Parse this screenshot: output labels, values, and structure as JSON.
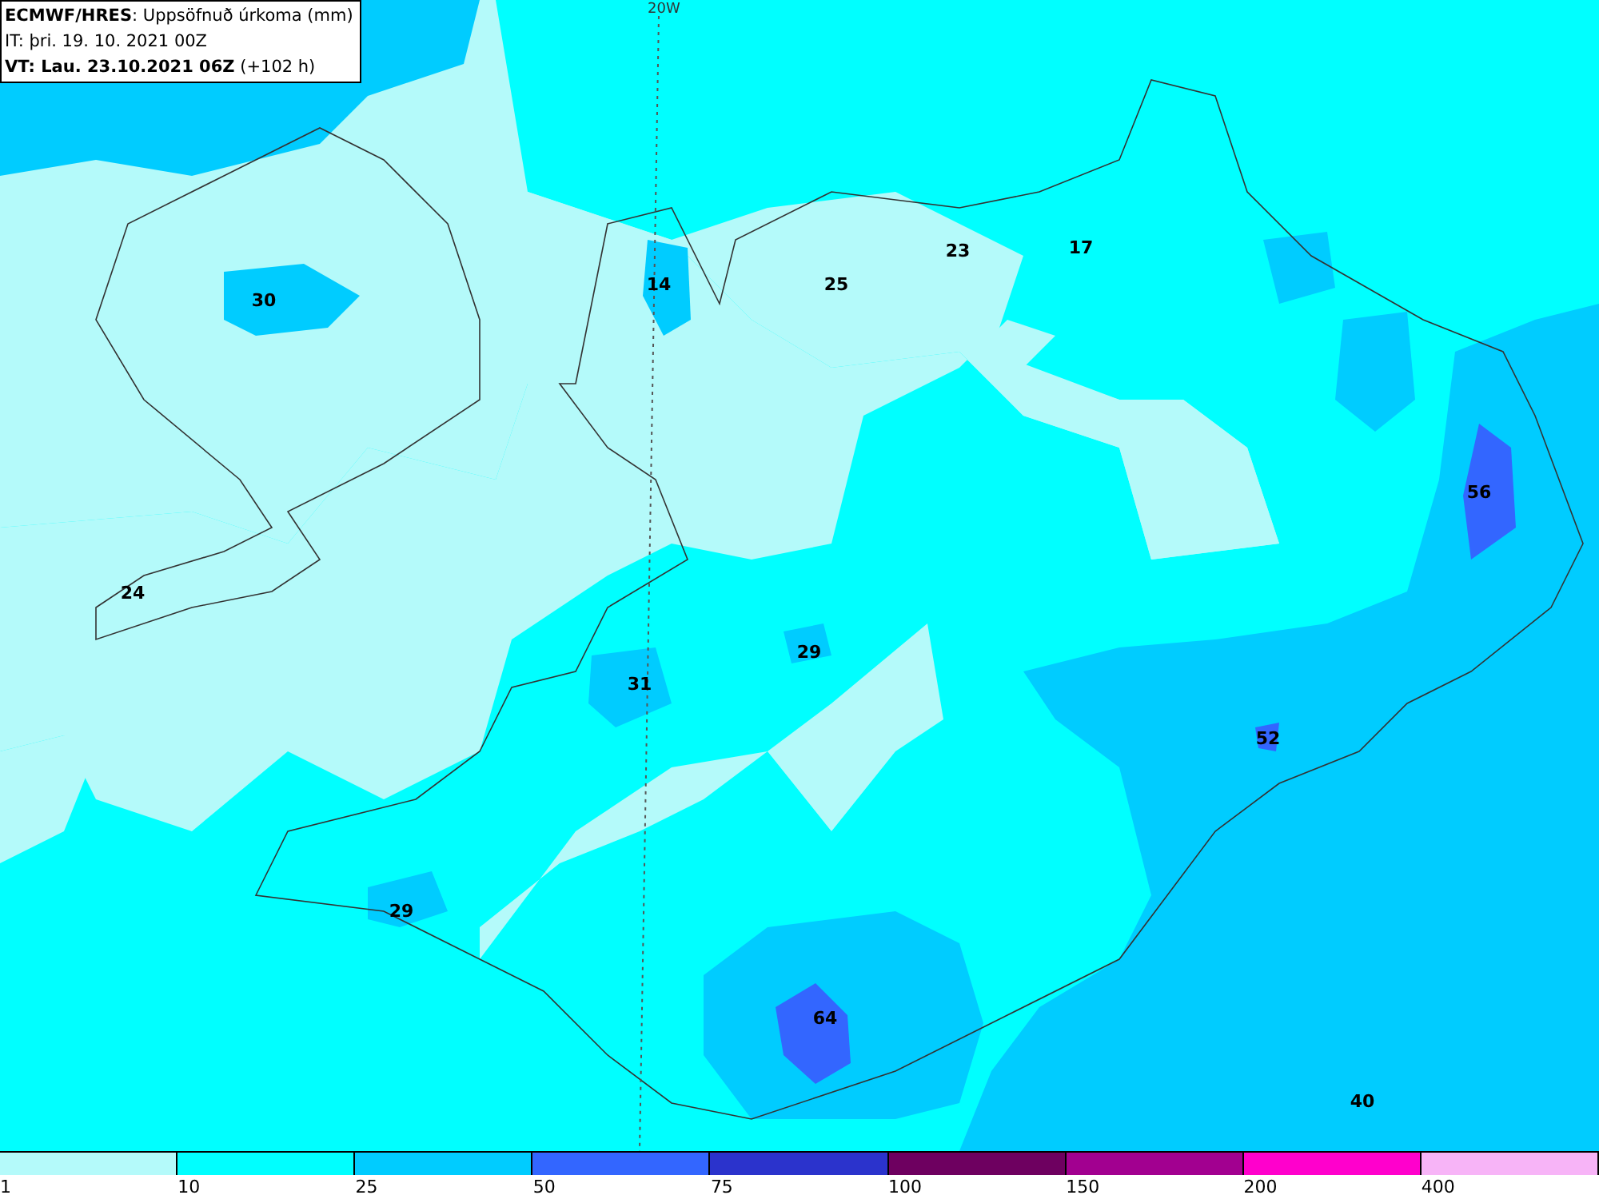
{
  "header": {
    "title": "**ECMWF/HRES**: Uppsöfnuð úrkoma (mm)",
    "init_time": "IT: þri. 19. 10. 2021 00Z",
    "valid_time": "**VT: Lau. 23.10.2021 06Z** (+102 h)"
  },
  "meridian_label": "20W",
  "map_values": [
    "30",
    "14",
    "25",
    "23",
    "17",
    "56",
    "24",
    "29",
    "31",
    "52",
    "29",
    "64",
    "40"
  ],
  "legend": {
    "swatches": [
      {
        "color": "#b4fafa"
      },
      {
        "color": "#00ffff"
      },
      {
        "color": "#00ccff"
      },
      {
        "color": "#3366ff"
      },
      {
        "color": "#2b33cc"
      },
      {
        "color": "#6e0060"
      },
      {
        "color": "#a20090"
      },
      {
        "color": "#ff00cc"
      },
      {
        "color": "#f7b4f7"
      }
    ],
    "ticks": [
      "1",
      "10",
      "25",
      "50",
      "75",
      "100",
      "150",
      "200",
      "400"
    ]
  }
}
